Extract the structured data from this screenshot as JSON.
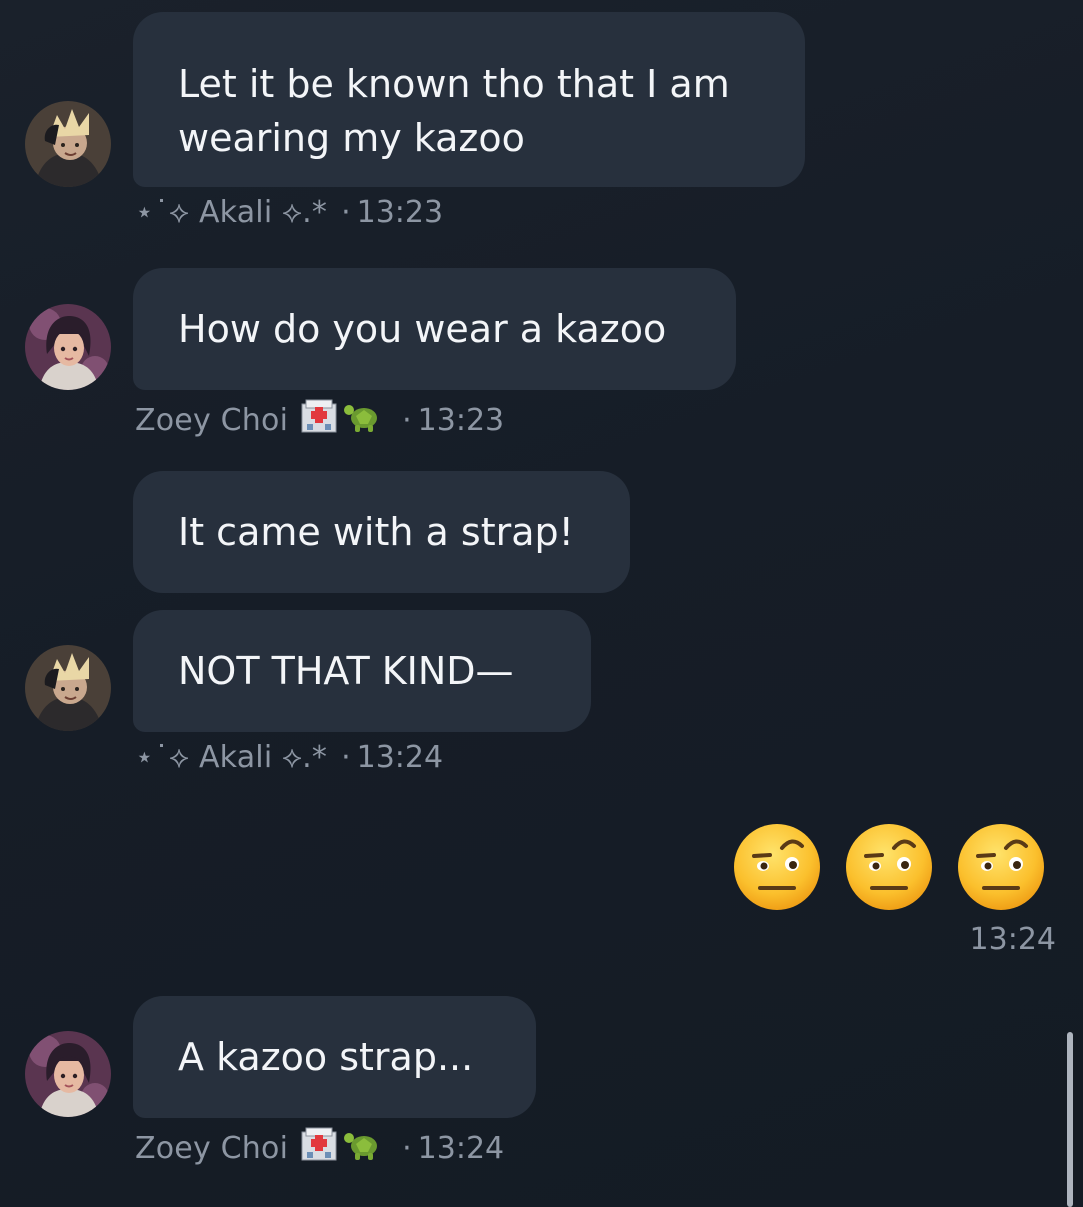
{
  "messages": [
    {
      "sender": "akali",
      "text": "Let it be known tho that I am wearing my kazoo"
    },
    {
      "sender": "zoey",
      "text": "How do you wear a kazoo"
    },
    {
      "sender": "zoey",
      "text": "It came with a strap!"
    },
    {
      "sender": "akali",
      "text": "NOT THAT KIND—"
    },
    {
      "sender": "self",
      "emoji": [
        "face-with-raised-eyebrow",
        "face-with-raised-eyebrow",
        "face-with-raised-eyebrow"
      ]
    },
    {
      "sender": "zoey",
      "text": "A kazoo strap..."
    }
  ],
  "meta": {
    "akali_name": "⋆˙⟡ Akali ⟡.*",
    "zoey_name": "Zoey Choi",
    "zoey_emojis": [
      "hospital-icon",
      "turtle-icon"
    ],
    "time_1": "13:23",
    "time_2": "13:23",
    "time_3": "13:24",
    "time_4": "13:24",
    "time_5": "13:24",
    "separator": "·"
  },
  "colors": {
    "background": "#151c26",
    "bubble": "#27303d",
    "meta_text": "#8d96a3",
    "text": "#f3f5f8"
  }
}
